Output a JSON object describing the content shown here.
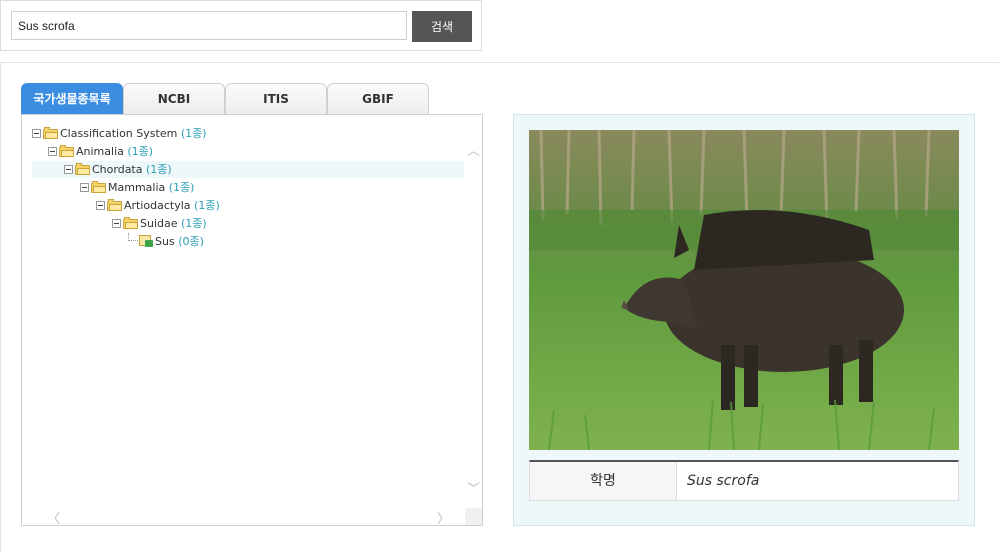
{
  "search": {
    "value": "Sus scrofa",
    "button_label": "검색"
  },
  "tabs": [
    {
      "label": "국가생물종목록",
      "active": true
    },
    {
      "label": "NCBI",
      "active": false
    },
    {
      "label": "ITIS",
      "active": false
    },
    {
      "label": "GBIF",
      "active": false
    }
  ],
  "tree": [
    {
      "name": "Classification System",
      "count": "(1종)",
      "depth": 0,
      "type": "folder",
      "selected": false
    },
    {
      "name": "Animalia",
      "count": "(1종)",
      "depth": 1,
      "type": "folder",
      "selected": false
    },
    {
      "name": "Chordata",
      "count": "(1종)",
      "depth": 2,
      "type": "folder",
      "selected": true
    },
    {
      "name": "Mammalia",
      "count": "(1종)",
      "depth": 3,
      "type": "folder",
      "selected": false
    },
    {
      "name": "Artiodactyla",
      "count": "(1종)",
      "depth": 4,
      "type": "folder",
      "selected": false
    },
    {
      "name": "Suidae",
      "count": "(1종)",
      "depth": 5,
      "type": "folder",
      "selected": false
    },
    {
      "name": "Sus",
      "count": "(0종)",
      "depth": 6,
      "type": "leaf",
      "selected": false
    }
  ],
  "species": {
    "label": "학명",
    "scientific_name": "Sus scrofa",
    "photo_icon": "wild-boar-photo"
  },
  "colors": {
    "active_tab": "#3a8de0",
    "count_text": "#2aa0b8",
    "search_button": "#555555",
    "info_panel_bg": "#eef7fa"
  }
}
